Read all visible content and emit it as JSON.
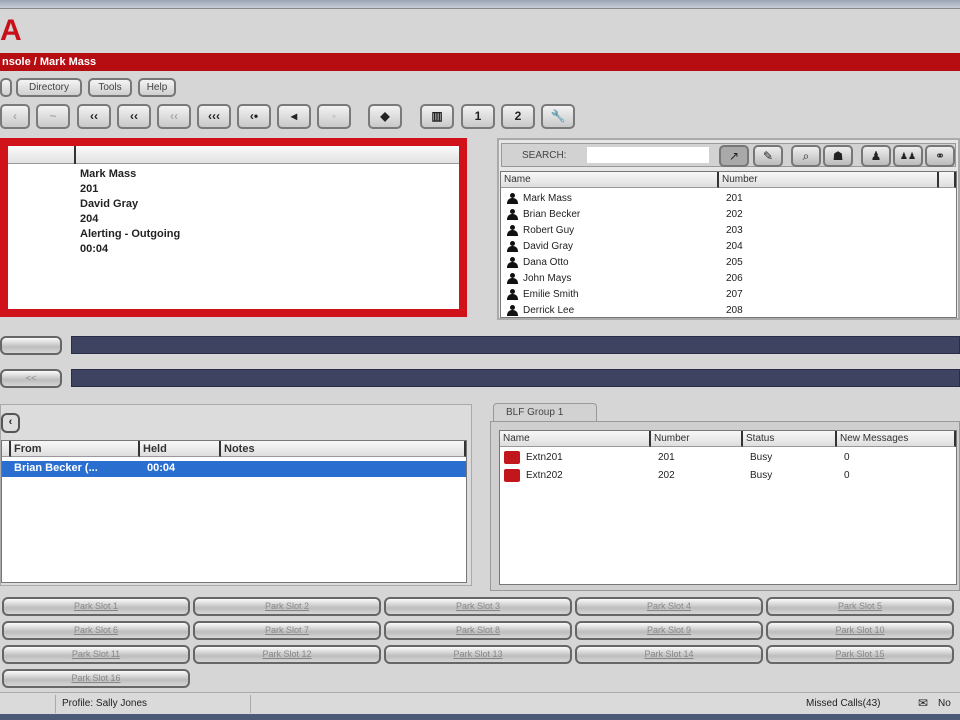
{
  "logo": "A",
  "title": "nsole / Mark Mass",
  "menu": [
    "",
    "Directory",
    "Tools",
    "Help"
  ],
  "toolbar_icons": [
    "back-icon",
    "drop-icon",
    "transfer-icon",
    "transfer-alt-icon",
    "transfer-disabled-icon",
    "conference-icon",
    "hold-icon",
    "speaker-icon",
    "mute-icon",
    "navigate-icon",
    "keypad-icon",
    "line1-icon",
    "line2-icon",
    "tools-icon"
  ],
  "toolbar_glyphs": [
    "‹",
    "~",
    "‹‹",
    "‹‹",
    "‹‹",
    "‹‹‹",
    "‹•",
    "◂",
    "◦",
    "◆",
    "▥",
    "1",
    "2",
    "🔧"
  ],
  "call_info": [
    "Mark Mass",
    "201",
    "David Gray",
    "204",
    "Alerting - Outgoing",
    "00:04"
  ],
  "directory": {
    "search_label": "SEARCH:",
    "search_value": "",
    "columns": [
      "Name",
      "Number",
      ""
    ],
    "rows": [
      [
        "Mark Mass",
        "201"
      ],
      [
        "Brian Becker",
        "202"
      ],
      [
        "Robert Guy",
        "203"
      ],
      [
        "David Gray",
        "204"
      ],
      [
        "Dana Otto",
        "205"
      ],
      [
        "John Mays",
        "206"
      ],
      [
        "Emilie Smith",
        "207"
      ],
      [
        "Derrick Lee",
        "208"
      ]
    ]
  },
  "bar_buttons": [
    "",
    "<<"
  ],
  "held": {
    "columns": [
      "",
      "From",
      "Held",
      "Notes"
    ],
    "rows": [
      [
        "",
        "Brian Becker (...",
        "00:04",
        ""
      ]
    ]
  },
  "blf": {
    "tab": "BLF Group 1",
    "columns": [
      "Name",
      "Number",
      "Status",
      "New Messages"
    ],
    "rows": [
      [
        "Extn201",
        "201",
        "Busy",
        "0"
      ],
      [
        "Extn202",
        "202",
        "Busy",
        "0"
      ]
    ]
  },
  "park_slots": [
    "Park Slot 1",
    "Park Slot 2",
    "Park Slot 3",
    "Park Slot 4",
    "Park Slot 5",
    "Park Slot 6",
    "Park Slot 7",
    "Park Slot 8",
    "Park Slot 9",
    "Park Slot 10",
    "Park Slot 11",
    "Park Slot 12",
    "Park Slot 13",
    "Park Slot 14",
    "Park Slot 15",
    "Park Slot 16"
  ],
  "status": {
    "profile": "Profile: Sally Jones",
    "missed": "Missed Calls(43)",
    "voicemail": "No"
  },
  "colors": {
    "accent_red": "#b50d12",
    "selection": "#2a6fd0",
    "navy": "#3d4360"
  }
}
